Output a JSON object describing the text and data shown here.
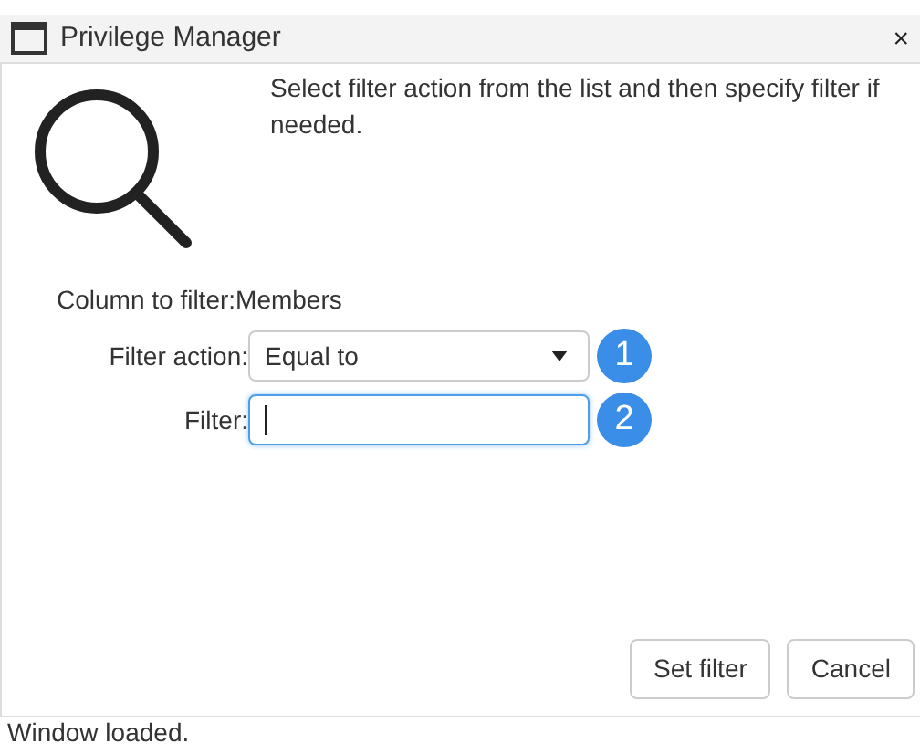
{
  "window": {
    "title": "Privilege Manager",
    "close": "×"
  },
  "instructions": "Select filter action from the list and then specify filter if needed.",
  "column_to_filter": {
    "label": "Column to filter:",
    "value": "Members"
  },
  "fields": [
    {
      "kind": "select",
      "label": "Filter action:",
      "value": "Equal to",
      "focused": false,
      "step": "1"
    },
    {
      "kind": "text",
      "label": "Filter:",
      "focused": true,
      "step": "2"
    }
  ],
  "buttons": [
    "Set filter",
    "Cancel"
  ],
  "status_bar": "Window loaded."
}
